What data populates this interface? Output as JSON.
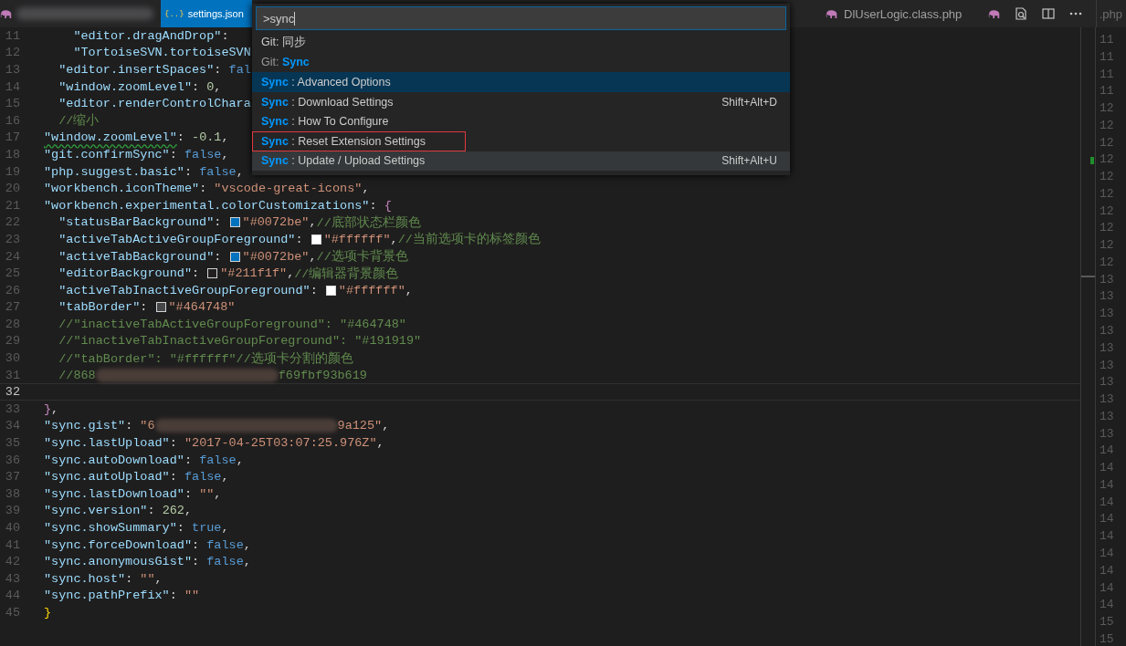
{
  "tabs": [
    {
      "kind": "php",
      "selected": false
    },
    {
      "kind": "json",
      "icon_text": "{..}",
      "label": "settings.json",
      "selected": true
    },
    {
      "kind": "php",
      "label": "DlUserLogic.class.php",
      "selected": false
    }
  ],
  "side_tab": {
    "label": ".php"
  },
  "palette": {
    "value": ">sync",
    "items": [
      {
        "text": "Git: 同步",
        "dim": false,
        "selected": false,
        "hover": false,
        "outlined": false
      },
      {
        "text": "Git: **Sync**",
        "dim": true,
        "selected": false,
        "hover": false,
        "outlined": false
      },
      {
        "text": "**Sync** : Advanced Options",
        "dim": false,
        "selected": true,
        "hover": false,
        "outlined": false
      },
      {
        "text": "**Sync** : Download Settings",
        "keybinding": "Shift+Alt+D",
        "dim": false,
        "selected": false,
        "hover": false,
        "outlined": false
      },
      {
        "text": "**Sync** : How To Configure",
        "dim": false,
        "selected": false,
        "hover": false,
        "outlined": false
      },
      {
        "text": "**Sync** : Reset Extension Settings",
        "dim": false,
        "selected": false,
        "hover": false,
        "outlined": true
      },
      {
        "text": "**Sync** : Update / Upload Settings",
        "keybinding": "Shift+Alt+U",
        "dim": false,
        "selected": false,
        "hover": true,
        "outlined": false
      }
    ]
  },
  "lines": [
    {
      "children": [
        {
          "children": [
            {
              "number": "11",
              "current": false,
              "tokens": [
                {
                  "kind": "key",
                  "text": "\"editor.dragAndDrop\""
                },
                {
                  "kind": "punct",
                  "text": ":"
                }
              ]
            },
            {
              "number": "12",
              "current": false,
              "tokens": [
                {
                  "kind": "key",
                  "text": "\"TortoiseSVN.tortoiseSVN"
                }
              ]
            }
          ]
        },
        {
          "number": "13",
          "current": false,
          "tokens": [
            {
              "kind": "key",
              "text": "\"editor.insertSpaces\""
            },
            {
              "kind": "punct",
              "text": ": "
            },
            {
              "kind": "bool",
              "text": "fal"
            }
          ]
        },
        {
          "number": "14",
          "current": false,
          "tokens": [
            {
              "kind": "key",
              "text": "\"window.zoomLevel\""
            },
            {
              "kind": "punct",
              "text": ": "
            },
            {
              "kind": "num",
              "text": "0"
            },
            {
              "kind": "punct",
              "text": ","
            }
          ]
        },
        {
          "number": "15",
          "current": false,
          "tokens": [
            {
              "kind": "key",
              "text": "\"editor.renderControlChara"
            }
          ]
        },
        {
          "number": "16",
          "current": false,
          "tokens": [
            {
              "kind": "comment",
              "text": "//缩小"
            }
          ]
        }
      ]
    },
    {
      "number": "17",
      "current": false,
      "tokens": [
        {
          "kind": "key",
          "text": "\"window.zoomLevel\"",
          "squiggle": true
        },
        {
          "kind": "punct",
          "text": ": "
        },
        {
          "kind": "num",
          "text": "-0.1"
        },
        {
          "kind": "punct",
          "text": ","
        }
      ]
    },
    {
      "number": "18",
      "current": false,
      "tokens": [
        {
          "kind": "key",
          "text": "\"git.confirmSync\""
        },
        {
          "kind": "punct",
          "text": ": "
        },
        {
          "kind": "bool",
          "text": "false"
        },
        {
          "kind": "punct",
          "text": ","
        }
      ]
    },
    {
      "number": "19",
      "current": false,
      "tokens": [
        {
          "kind": "key",
          "text": "\"php.suggest.basic\""
        },
        {
          "kind": "punct",
          "text": ": "
        },
        {
          "kind": "bool",
          "text": "false"
        },
        {
          "kind": "punct",
          "text": ","
        }
      ]
    },
    {
      "number": "20",
      "current": false,
      "tokens": [
        {
          "kind": "key",
          "text": "\"workbench.iconTheme\""
        },
        {
          "kind": "punct",
          "text": ": "
        },
        {
          "kind": "str",
          "text": "\"vscode-great-icons\""
        },
        {
          "kind": "punct",
          "text": ","
        }
      ]
    },
    {
      "number": "21",
      "current": false,
      "tokens": [
        {
          "kind": "key",
          "text": "\"workbench.experimental.colorCustomizations\""
        },
        {
          "kind": "punct",
          "text": ": "
        },
        {
          "kind": "brace",
          "text": "{"
        }
      ],
      "children": [
        {
          "number": "22",
          "current": false,
          "tokens": [
            {
              "kind": "key",
              "text": "\"statusBarBackground\""
            },
            {
              "kind": "punct",
              "text": ": "
            },
            {
              "kind": "swatch",
              "color": "#0072be"
            },
            {
              "kind": "str",
              "text": "\"#0072be\""
            },
            {
              "kind": "punct",
              "text": ","
            },
            {
              "kind": "comment",
              "text": "//底部状态栏颜色"
            }
          ]
        },
        {
          "number": "23",
          "current": false,
          "tokens": [
            {
              "kind": "key",
              "text": "\"activeTabActiveGroupForeground\""
            },
            {
              "kind": "punct",
              "text": ": "
            },
            {
              "kind": "swatch",
              "color": "#ffffff"
            },
            {
              "kind": "str",
              "text": "\"#ffffff\""
            },
            {
              "kind": "punct",
              "text": ","
            },
            {
              "kind": "comment",
              "text": "//当前选项卡的标签颜色"
            }
          ]
        },
        {
          "number": "24",
          "current": false,
          "tokens": [
            {
              "kind": "key",
              "text": "\"activeTabBackground\""
            },
            {
              "kind": "punct",
              "text": ": "
            },
            {
              "kind": "swatch",
              "color": "#0072be"
            },
            {
              "kind": "str",
              "text": "\"#0072be\""
            },
            {
              "kind": "punct",
              "text": ","
            },
            {
              "kind": "comment",
              "text": "//选项卡背景色"
            }
          ]
        },
        {
          "number": "25",
          "current": false,
          "tokens": [
            {
              "kind": "key",
              "text": "\"editorBackground\""
            },
            {
              "kind": "punct",
              "text": ": "
            },
            {
              "kind": "swatch",
              "color": "#211f1f"
            },
            {
              "kind": "str",
              "text": "\"#211f1f\""
            },
            {
              "kind": "punct",
              "text": ","
            },
            {
              "kind": "comment",
              "text": "//编辑器背景颜色"
            }
          ]
        },
        {
          "number": "26",
          "current": false,
          "tokens": [
            {
              "kind": "key",
              "text": "\"activeTabInactiveGroupForeground\""
            },
            {
              "kind": "punct",
              "text": ": "
            },
            {
              "kind": "swatch",
              "color": "#ffffff"
            },
            {
              "kind": "str",
              "text": "\"#ffffff\""
            },
            {
              "kind": "punct",
              "text": ","
            }
          ]
        },
        {
          "number": "27",
          "current": false,
          "tokens": [
            {
              "kind": "key",
              "text": "\"tabBorder\""
            },
            {
              "kind": "punct",
              "text": ": "
            },
            {
              "kind": "swatch",
              "color": "#464748"
            },
            {
              "kind": "str",
              "text": "\"#464748\""
            }
          ]
        },
        {
          "number": "28",
          "current": false,
          "tokens": [
            {
              "kind": "comment",
              "text": "//\"inactiveTabActiveGroupForeground\": \"#464748\""
            }
          ]
        },
        {
          "number": "29",
          "current": false,
          "tokens": [
            {
              "kind": "comment",
              "text": "//\"inactiveTabInactiveGroupForeground\": \"#191919\""
            }
          ]
        },
        {
          "number": "30",
          "current": false,
          "tokens": [
            {
              "kind": "comment",
              "text": "//\"tabBorder\": \"#ffffff\"//选项卡分割的颜色"
            }
          ]
        },
        {
          "number": "31",
          "current": false,
          "tokens": [
            {
              "kind": "comment",
              "text": "//868"
            },
            {
              "kind": "blur"
            },
            {
              "kind": "comment",
              "text": "f69fbf93b619"
            }
          ]
        }
      ]
    },
    {
      "number": "32",
      "current": true
    },
    {
      "number": "33",
      "current": false,
      "tokens": [
        {
          "kind": "brace",
          "text": "}"
        },
        {
          "kind": "punct",
          "text": ","
        }
      ]
    },
    {
      "number": "34",
      "current": false,
      "tokens": [
        {
          "kind": "key",
          "text": "\"sync.gist\""
        },
        {
          "kind": "punct",
          "text": ": "
        },
        {
          "kind": "str",
          "text": "\"6"
        },
        {
          "kind": "blur"
        },
        {
          "kind": "str",
          "text": "9a125\""
        },
        {
          "kind": "punct",
          "text": ","
        }
      ]
    },
    {
      "number": "35",
      "current": false,
      "tokens": [
        {
          "kind": "key",
          "text": "\"sync.lastUpload\""
        },
        {
          "kind": "punct",
          "text": ": "
        },
        {
          "kind": "str",
          "text": "\"2017-04-25T03:07:25.976Z\""
        },
        {
          "kind": "punct",
          "text": ","
        }
      ]
    },
    {
      "number": "36",
      "current": false,
      "tokens": [
        {
          "kind": "key",
          "text": "\"sync.autoDownload\""
        },
        {
          "kind": "punct",
          "text": ": "
        },
        {
          "kind": "bool",
          "text": "false"
        },
        {
          "kind": "punct",
          "text": ","
        }
      ]
    },
    {
      "number": "37",
      "current": false,
      "tokens": [
        {
          "kind": "key",
          "text": "\"sync.autoUpload\""
        },
        {
          "kind": "punct",
          "text": ": "
        },
        {
          "kind": "bool",
          "text": "false"
        },
        {
          "kind": "punct",
          "text": ","
        }
      ]
    },
    {
      "number": "38",
      "current": false,
      "tokens": [
        {
          "kind": "key",
          "text": "\"sync.lastDownload\""
        },
        {
          "kind": "punct",
          "text": ": "
        },
        {
          "kind": "str",
          "text": "\"\""
        },
        {
          "kind": "punct",
          "text": ","
        }
      ]
    },
    {
      "number": "39",
      "current": false,
      "tokens": [
        {
          "kind": "key",
          "text": "\"sync.version\""
        },
        {
          "kind": "punct",
          "text": ": "
        },
        {
          "kind": "num",
          "text": "262"
        },
        {
          "kind": "punct",
          "text": ","
        }
      ]
    },
    {
      "number": "40",
      "current": false,
      "tokens": [
        {
          "kind": "key",
          "text": "\"sync.showSummary\""
        },
        {
          "kind": "punct",
          "text": ": "
        },
        {
          "kind": "bool",
          "text": "true"
        },
        {
          "kind": "punct",
          "text": ","
        }
      ]
    },
    {
      "number": "41",
      "current": false,
      "tokens": [
        {
          "kind": "key",
          "text": "\"sync.forceDownload\""
        },
        {
          "kind": "punct",
          "text": ": "
        },
        {
          "kind": "bool",
          "text": "false"
        },
        {
          "kind": "punct",
          "text": ","
        }
      ]
    },
    {
      "number": "42",
      "current": false,
      "tokens": [
        {
          "kind": "key",
          "text": "\"sync.anonymousGist\""
        },
        {
          "kind": "punct",
          "text": ": "
        },
        {
          "kind": "bool",
          "text": "false"
        },
        {
          "kind": "punct",
          "text": ","
        }
      ]
    },
    {
      "number": "43",
      "current": false,
      "tokens": [
        {
          "kind": "key",
          "text": "\"sync.host\""
        },
        {
          "kind": "punct",
          "text": ": "
        },
        {
          "kind": "str",
          "text": "\"\""
        },
        {
          "kind": "punct",
          "text": ","
        }
      ]
    },
    {
      "number": "44",
      "current": false,
      "tokens": [
        {
          "kind": "key",
          "text": "\"sync.pathPrefix\""
        },
        {
          "kind": "punct",
          "text": ": "
        },
        {
          "kind": "str",
          "text": "\"\""
        }
      ]
    },
    {
      "number": "45",
      "current": false,
      "tokens": [
        {
          "kind": "brace2",
          "text": "}"
        }
      ]
    }
  ],
  "side_line_numbers": [
    "11",
    "11",
    "11",
    "11",
    "12",
    "12",
    "12",
    "12",
    "12",
    "12",
    "12",
    "12",
    "12",
    "12",
    "13",
    "13",
    "13",
    "13",
    "13",
    "13",
    "13",
    "13",
    "13",
    "13",
    "14",
    "14",
    "14",
    "14",
    "14",
    "14",
    "14",
    "14",
    "14",
    "14",
    "15",
    "15"
  ]
}
